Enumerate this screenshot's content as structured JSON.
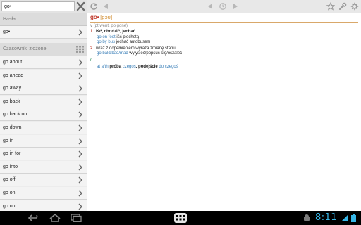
{
  "search": {
    "value": "go•"
  },
  "sections": {
    "entries": "Hasła",
    "phrasal": "Czasowniki złożone"
  },
  "entry_list": [
    "go•"
  ],
  "phrasal_list": [
    "go about",
    "go ahead",
    "go away",
    "go back",
    "go back on",
    "go down",
    "go in",
    "go in for",
    "go into",
    "go off",
    "go on",
    "go out"
  ],
  "entry": {
    "headword": "go•",
    "pronunciation": "[gəʊ]",
    "forms": "v (pt went, pp gone)",
    "senses": [
      {
        "num": "1.",
        "def": "iść, chodzić, jechać",
        "ex1_en": "go on foot",
        "ex1_pl": "iść piechotą",
        "ex2_en": "go by bus",
        "ex2_pl": "jechać autobusem"
      },
      {
        "num": "2.",
        "def": "wraz z dopełnieniem wyraża zmianę stanu",
        "ex1_en": "go bald/bad/mad",
        "ex1_pl": "wyłysieć/popsuć się/oszaleć"
      }
    ],
    "noun_label": "n",
    "noun_ex_prefix": "at a/th",
    "noun_ex_pl1": "próba",
    "noun_ex_en1": "czegoś",
    "noun_ex_pl2": ", podejście",
    "noun_ex_en2": "do czegoś"
  },
  "system": {
    "clock": "8:11"
  },
  "colors": {
    "accent": "#37b6e6",
    "headword": "#c0392b",
    "link": "#3a7fb8"
  }
}
